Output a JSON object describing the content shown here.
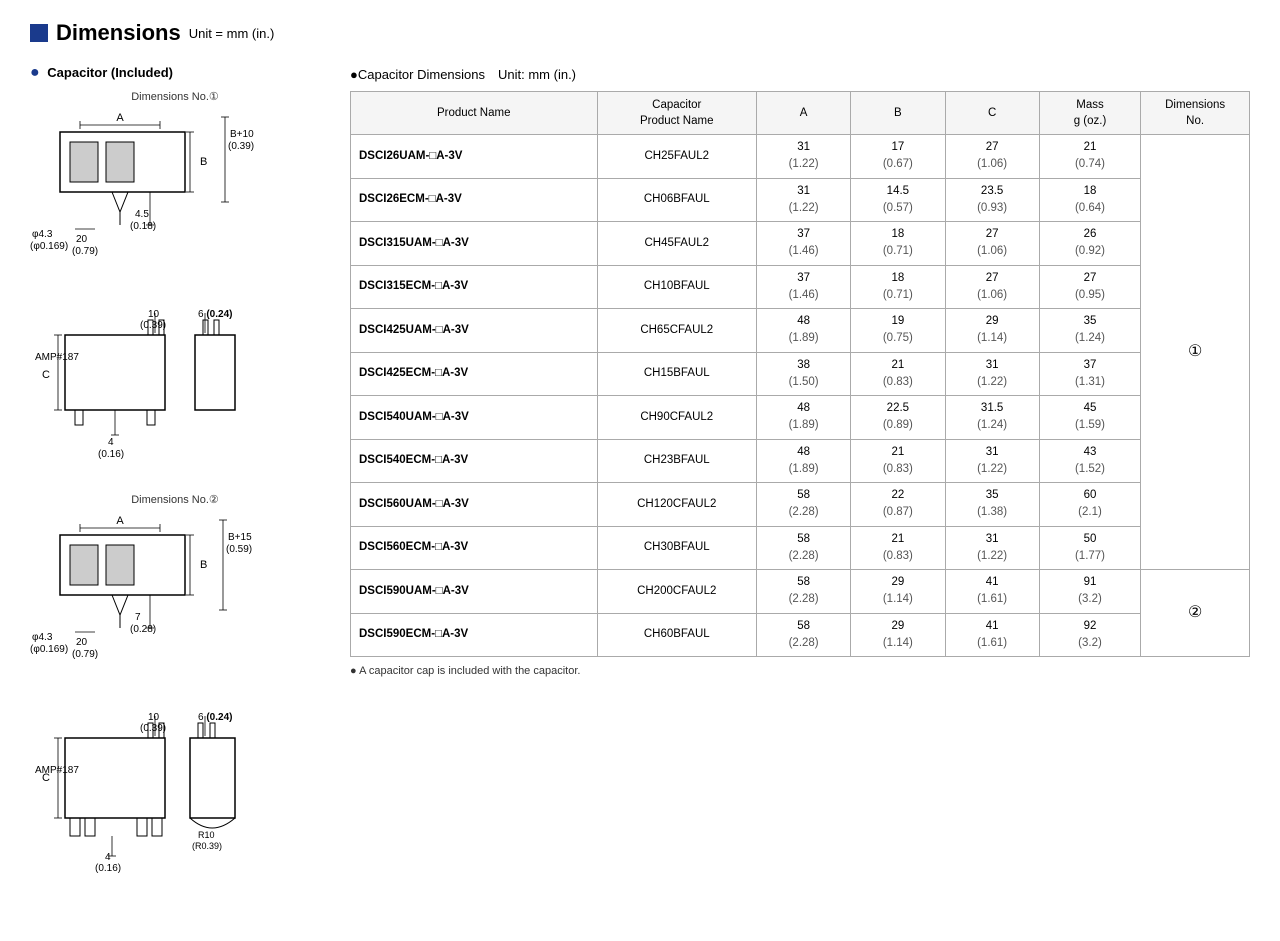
{
  "header": {
    "title": "Dimensions",
    "unit": "Unit = mm (in.)"
  },
  "left": {
    "subtitle": "Capacitor (Included)",
    "diagram1_label": "Dimensions No.①",
    "diagram2_label": "Dimensions No.②"
  },
  "right": {
    "table_header": "●Capacitor Dimensions　Unit: mm (in.)",
    "columns": [
      "Product Name",
      "Capacitor\nProduct Name",
      "A",
      "B",
      "C",
      "Mass\ng (oz.)",
      "Dimensions\nNo."
    ],
    "rows": [
      {
        "product": "DSCI26UAM-□A-3V",
        "cap": "CH25FAUL2",
        "A": "31\n(1.22)",
        "B": "17\n(0.67)",
        "C": "27\n(1.06)",
        "mass": "21\n(0.74)",
        "dim_no": "①",
        "dim_no_span": 10
      },
      {
        "product": "DSCI26ECM-□A-3V",
        "cap": "CH06BFAUL",
        "A": "31\n(1.22)",
        "B": "14.5\n(0.57)",
        "C": "23.5\n(0.93)",
        "mass": "18\n(0.64)",
        "dim_no": null
      },
      {
        "product": "DSCI315UAM-□A-3V",
        "cap": "CH45FAUL2",
        "A": "37\n(1.46)",
        "B": "18\n(0.71)",
        "C": "27\n(1.06)",
        "mass": "26\n(0.92)",
        "dim_no": null
      },
      {
        "product": "DSCI315ECM-□A-3V",
        "cap": "CH10BFAUL",
        "A": "37\n(1.46)",
        "B": "18\n(0.71)",
        "C": "27\n(1.06)",
        "mass": "27\n(0.95)",
        "dim_no": null
      },
      {
        "product": "DSCI425UAM-□A-3V",
        "cap": "CH65CFAUL2",
        "A": "48\n(1.89)",
        "B": "19\n(0.75)",
        "C": "29\n(1.14)",
        "mass": "35\n(1.24)",
        "dim_no": null
      },
      {
        "product": "DSCI425ECM-□A-3V",
        "cap": "CH15BFAUL",
        "A": "38\n(1.50)",
        "B": "21\n(0.83)",
        "C": "31\n(1.22)",
        "mass": "37\n(1.31)",
        "dim_no": null
      },
      {
        "product": "DSCI540UAM-□A-3V",
        "cap": "CH90CFAUL2",
        "A": "48\n(1.89)",
        "B": "22.5\n(0.89)",
        "C": "31.5\n(1.24)",
        "mass": "45\n(1.59)",
        "dim_no": null
      },
      {
        "product": "DSCI540ECM-□A-3V",
        "cap": "CH23BFAUL",
        "A": "48\n(1.89)",
        "B": "21\n(0.83)",
        "C": "31\n(1.22)",
        "mass": "43\n(1.52)",
        "dim_no": null
      },
      {
        "product": "DSCI560UAM-□A-3V",
        "cap": "CH120CFAUL2",
        "A": "58\n(2.28)",
        "B": "22\n(0.87)",
        "C": "35\n(1.38)",
        "mass": "60\n(2.1)",
        "dim_no": null
      },
      {
        "product": "DSCI560ECM-□A-3V",
        "cap": "CH30BFAUL",
        "A": "58\n(2.28)",
        "B": "21\n(0.83)",
        "C": "31\n(1.22)",
        "mass": "50\n(1.77)",
        "dim_no": null
      },
      {
        "product": "DSCI590UAM-□A-3V",
        "cap": "CH200CFAUL2",
        "A": "58\n(2.28)",
        "B": "29\n(1.14)",
        "C": "41\n(1.61)",
        "mass": "91\n(3.2)",
        "dim_no": "②",
        "dim_no_span": 2
      },
      {
        "product": "DSCI590ECM-□A-3V",
        "cap": "CH60BFAUL",
        "A": "58\n(2.28)",
        "B": "29\n(1.14)",
        "C": "41\n(1.61)",
        "mass": "92\n(3.2)",
        "dim_no": null
      }
    ],
    "footnote": "● A capacitor cap is included with the capacitor."
  }
}
